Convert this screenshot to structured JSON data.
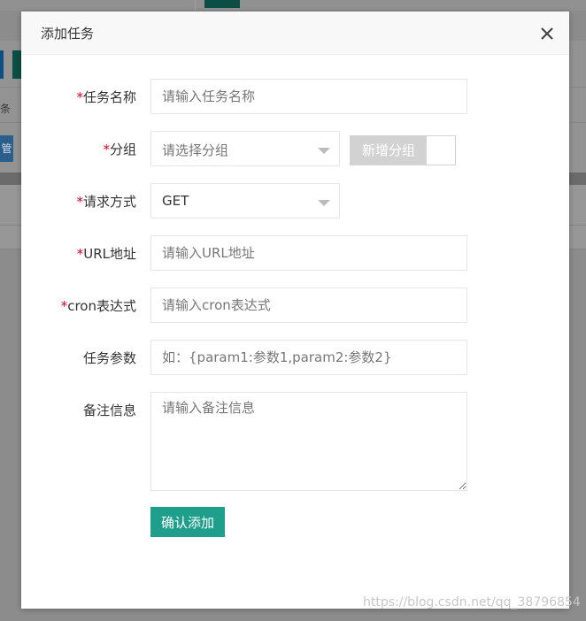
{
  "background": {
    "left_label_char": "条",
    "blue_button_char": "管"
  },
  "modal": {
    "title": "添加任务",
    "close_icon": "close-icon"
  },
  "form": {
    "required_mark": "*",
    "task_name": {
      "label": "任务名称",
      "placeholder": "请输入任务名称",
      "value": ""
    },
    "group": {
      "label": "分组",
      "placeholder": "请选择分组",
      "add_group_label": "新增分组"
    },
    "method": {
      "label": "请求方式",
      "value": "GET"
    },
    "url": {
      "label": "URL地址",
      "placeholder": "请输入URL地址",
      "value": ""
    },
    "cron": {
      "label": "cron表达式",
      "placeholder": "请输入cron表达式",
      "value": ""
    },
    "params": {
      "label": "任务参数",
      "placeholder": "如：{param1:参数1,param2:参数2}",
      "value": ""
    },
    "remark": {
      "label": "备注信息",
      "placeholder": "请输入备注信息",
      "value": ""
    },
    "submit_label": "确认添加"
  },
  "watermark": "https://blog.csdn.net/qq_38796854",
  "colors": {
    "accent": "#1e9e8b",
    "required": "#d9001b",
    "overlay": "#8c8c8c"
  }
}
